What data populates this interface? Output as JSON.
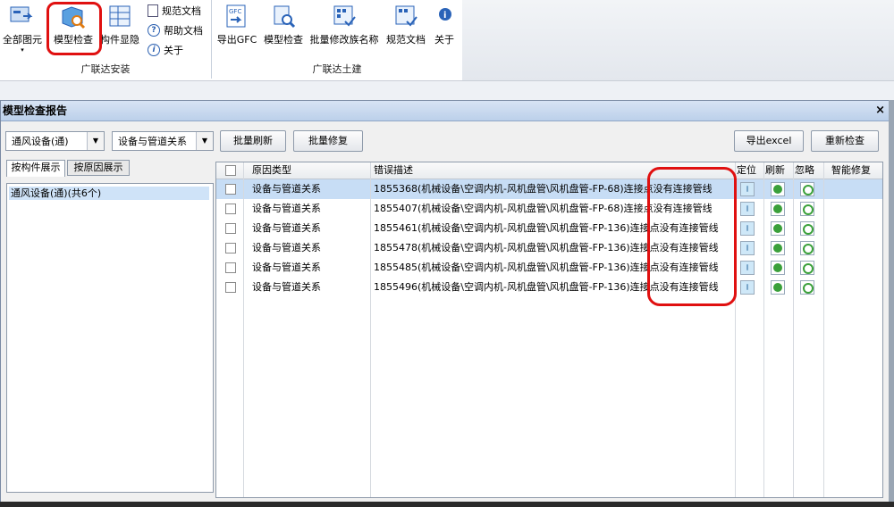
{
  "ribbon": {
    "install_group": {
      "label": "广联达安装",
      "buttons": [
        {
          "label": "全部图元"
        },
        {
          "label": "模型检查"
        },
        {
          "label": "构件显隐"
        }
      ],
      "small_buttons": [
        {
          "label": "规范文档"
        },
        {
          "label": "帮助文档"
        },
        {
          "label": "关于"
        }
      ]
    },
    "civil_group": {
      "label": "广联达土建",
      "buttons": [
        {
          "label": "导出GFC"
        },
        {
          "label": "模型检查"
        },
        {
          "label": "批量修改族名称"
        },
        {
          "label": "规范文档"
        },
        {
          "label": "关于"
        }
      ]
    }
  },
  "dialog": {
    "title": "模型检查报告",
    "close": "×",
    "combo1": "通风设备(通)",
    "combo2": "设备与管道关系",
    "batch_refresh": "批量刷新",
    "batch_fix": "批量修复",
    "export_excel": "导出excel",
    "recheck": "重新检查",
    "tabs": [
      "按构件展示",
      "按原因展示"
    ],
    "tree_item": "通风设备(通)(共6个)",
    "columns": {
      "reason": "原因类型",
      "desc": "错误描述",
      "locate": "定位",
      "refresh": "刷新",
      "ignore": "忽略",
      "smart_fix": "智能修复"
    },
    "rows": [
      {
        "reason": "设备与管道关系",
        "desc": "1855368(机械设备\\空调内机-风机盘管\\风机盘管-FP-68)连接点没有连接管线"
      },
      {
        "reason": "设备与管道关系",
        "desc": "1855407(机械设备\\空调内机-风机盘管\\风机盘管-FP-68)连接点没有连接管线"
      },
      {
        "reason": "设备与管道关系",
        "desc": "1855461(机械设备\\空调内机-风机盘管\\风机盘管-FP-136)连接点没有连接管线"
      },
      {
        "reason": "设备与管道关系",
        "desc": "1855478(机械设备\\空调内机-风机盘管\\风机盘管-FP-136)连接点没有连接管线"
      },
      {
        "reason": "设备与管道关系",
        "desc": "1855485(机械设备\\空调内机-风机盘管\\风机盘管-FP-136)连接点没有连接管线"
      },
      {
        "reason": "设备与管道关系",
        "desc": "1855496(机械设备\\空调内机-风机盘管\\风机盘管-FP-136)连接点没有连接管线"
      }
    ]
  },
  "colors": {
    "highlight": "#e01010",
    "selected_row": "#c7ddf5",
    "accent": "#3aa03a"
  }
}
